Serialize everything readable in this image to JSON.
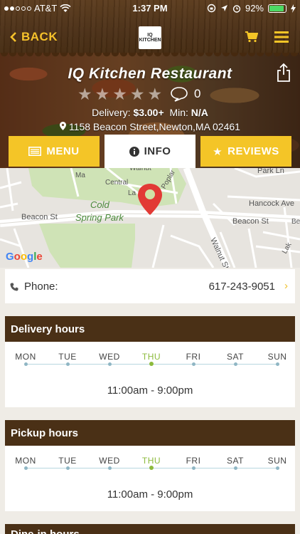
{
  "status_bar": {
    "carrier": "AT&T",
    "time": "1:37 PM",
    "battery": "92%",
    "battery_level": 0.92
  },
  "nav": {
    "back_label": "BACK",
    "logo_text": "IQ KITCHEN"
  },
  "restaurant": {
    "name": "IQ Kitchen Restaurant",
    "rating": 0,
    "review_count": "0",
    "delivery_label": "Delivery:",
    "delivery_fee": "$3.00+",
    "min_label": "Min:",
    "min_value": "N/A",
    "address": "1158 Beacon Street,Newton,MA 02461"
  },
  "tabs": [
    {
      "label": "MENU",
      "icon": "menu-list-icon",
      "active": false
    },
    {
      "label": "INFO",
      "icon": "info-icon",
      "active": true
    },
    {
      "label": "REVIEWS",
      "icon": "star-icon",
      "active": false
    }
  ],
  "map": {
    "labels": [
      "Beacon St",
      "Cold",
      "Spring Park",
      "Beacon St",
      "Hancock Ave",
      "Park Ln",
      "Central",
      "Walnut",
      "Walnut St",
      "Poplar",
      "La",
      "Ma",
      "Lak",
      "Be",
      "Google"
    ]
  },
  "phone": {
    "label": "Phone:",
    "number": "617-243-9051"
  },
  "delivery_hours": {
    "title": "Delivery hours",
    "days": [
      "MON",
      "TUE",
      "WED",
      "THU",
      "FRI",
      "SAT",
      "SUN"
    ],
    "today": "THU",
    "hours": "11:00am - 9:00pm"
  },
  "pickup_hours": {
    "title": "Pickup hours",
    "days": [
      "MON",
      "TUE",
      "WED",
      "THU",
      "FRI",
      "SAT",
      "SUN"
    ],
    "today": "THU",
    "hours": "11:00am - 9:00pm"
  },
  "next_section": {
    "title": "Dine-in hours"
  },
  "colors": {
    "accent": "#f4c527",
    "header_brown": "#4a3016",
    "today_green": "#8cba3c",
    "timeline_blue": "#b8d7df"
  }
}
